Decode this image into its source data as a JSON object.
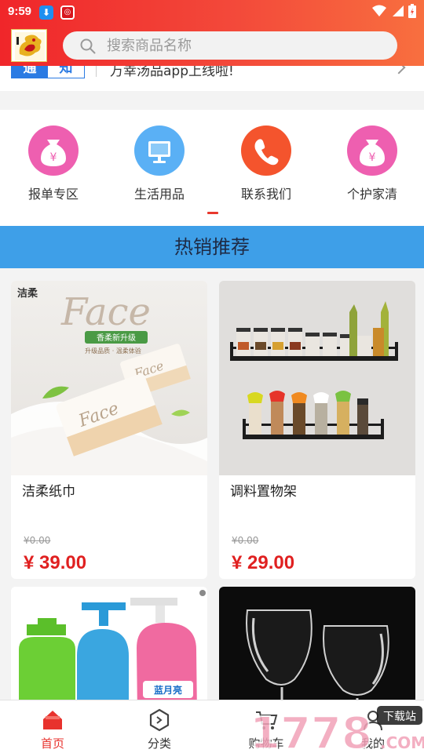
{
  "status_bar": {
    "time": "9:59"
  },
  "header": {
    "search_placeholder": "搜索商品名称",
    "accent_color": "#f0262a"
  },
  "notice": {
    "tag_part1": "通",
    "tag_part2": "知",
    "text": "万幸汤品app上线啦!"
  },
  "categories": [
    {
      "label": "报单专区",
      "icon": "money-bag-icon",
      "color": "#ee5fb0"
    },
    {
      "label": "生活用品",
      "icon": "monitor-icon",
      "color": "#4aa3f0"
    },
    {
      "label": "联系我们",
      "icon": "phone-icon",
      "color": "#f4542d"
    },
    {
      "label": "个护家清",
      "icon": "money-bag-icon",
      "color": "#ee5fb0"
    }
  ],
  "section_title": "热销推荐",
  "products": [
    {
      "name": "洁柔纸巾",
      "old_price": "¥0.00",
      "price": "¥ 39.00",
      "brand": "洁柔",
      "img_text": "Face",
      "img_sub": "香柔新升级",
      "img_sub2": "升级品质 · 温柔体验"
    },
    {
      "name": "调料置物架",
      "old_price": "¥0.00",
      "price": "¥ 29.00"
    },
    {
      "name": "",
      "img_text": "蓝月亮"
    },
    {
      "name": ""
    }
  ],
  "tabbar": {
    "items": [
      {
        "label": "首页",
        "icon": "home-icon",
        "active": true
      },
      {
        "label": "分类",
        "icon": "category-icon",
        "active": false
      },
      {
        "label": "购物车",
        "icon": "cart-icon",
        "active": false
      },
      {
        "label": "我的",
        "icon": "user-icon",
        "active": false
      }
    ]
  },
  "watermark": {
    "text": "1778",
    "suffix": ".COM",
    "badge": "下载站"
  }
}
